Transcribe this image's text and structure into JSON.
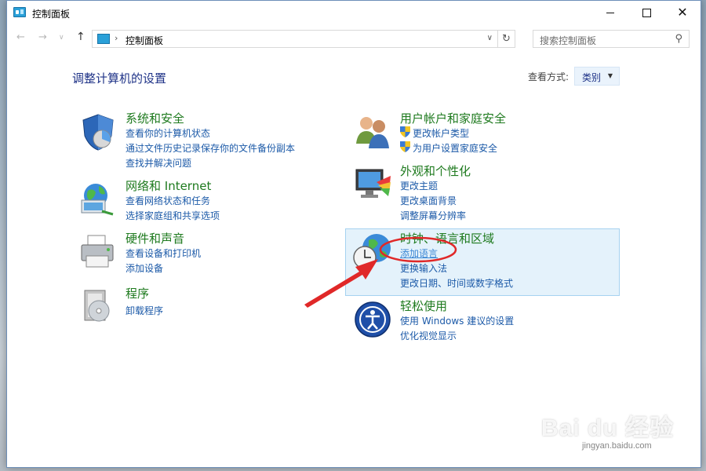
{
  "window": {
    "title": "控制面板"
  },
  "navigation": {
    "address_path": "控制面板",
    "search_placeholder": "搜索控制面板"
  },
  "content": {
    "page_title": "调整计算机的设置",
    "view_by_label": "查看方式:",
    "view_by_value": "类别"
  },
  "categories": [
    {
      "title": "系统和安全",
      "icon": "shield-icon",
      "links": [
        "查看你的计算机状态",
        "通过文件历史记录保存你的文件备份副本",
        "查找并解决问题"
      ]
    },
    {
      "title": "网络和 Internet",
      "icon": "network-globe-icon",
      "links": [
        "查看网络状态和任务",
        "选择家庭组和共享选项"
      ]
    },
    {
      "title": "硬件和声音",
      "icon": "printer-icon",
      "links": [
        "查看设备和打印机",
        "添加设备"
      ]
    },
    {
      "title": "程序",
      "icon": "programs-disc-icon",
      "links": [
        "卸载程序"
      ]
    },
    {
      "title": "用户帐户和家庭安全",
      "icon": "users-icon",
      "links": [
        "更改帐户类型",
        "为用户设置家庭安全"
      ]
    },
    {
      "title": "外观和个性化",
      "icon": "monitor-palette-icon",
      "links": [
        "更改主题",
        "更改桌面背景",
        "调整屏幕分辨率"
      ]
    },
    {
      "title": "时钟、语言和区域",
      "icon": "clock-globe-icon",
      "links": [
        "添加语言",
        "更换输入法",
        "更改日期、时间或数字格式"
      ]
    },
    {
      "title": "轻松使用",
      "icon": "ease-of-access-icon",
      "links": [
        "使用 Windows 建议的设置",
        "优化视觉显示"
      ]
    }
  ],
  "watermark": {
    "brand": "Bai du 经验",
    "url": "jingyan.baidu.com"
  },
  "colors": {
    "category_title": "#1e7a1e",
    "link": "#1c5aa8",
    "highlight_bg": "#e4f2fb",
    "annotation_red": "#e02828"
  }
}
